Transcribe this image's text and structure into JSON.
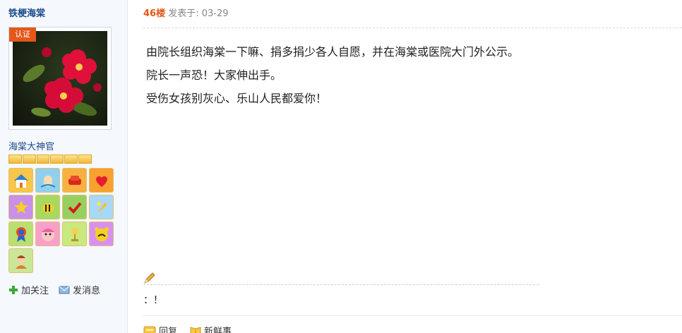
{
  "user": {
    "name": "铁梗海棠",
    "cert_badge": "认证",
    "rank_title": "海棠大神官",
    "rank_level": 1.0,
    "medals": [
      "home-icon",
      "wave-hand-icon",
      "sofa-icon",
      "heart-icon",
      "star-icon",
      "bee-icon",
      "check-icon",
      "feather-icon",
      "rosette-icon",
      "pink-face-icon",
      "trophy-icon",
      "bear-face-icon",
      "person-icon"
    ],
    "follow_label": "加关注",
    "message_label": "发消息"
  },
  "post": {
    "floor": "46楼",
    "posted_at": "发表于: 03-29",
    "lines": [
      "由院长组织海棠一下嘛、捐多捐少各人自愿，并在海棠或医院大门外公示。",
      "院长一声恐！大家伸出手。",
      "受伤女孩别灰心、乐山人民都爱你！"
    ],
    "signature": "：！",
    "actions": {
      "reply": "回复",
      "fresh": "新鲜事"
    }
  }
}
